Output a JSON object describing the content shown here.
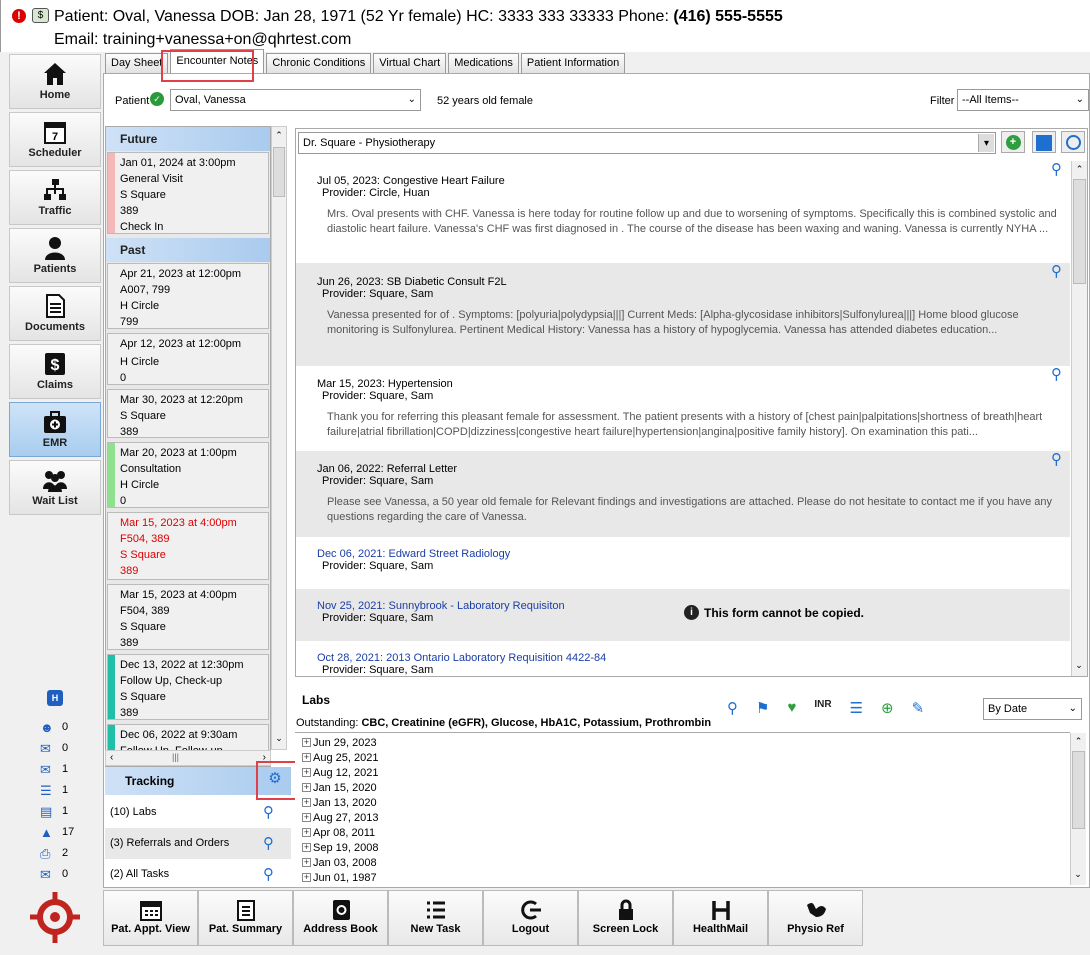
{
  "header": {
    "patient_line": "Patient: Oval, Vanessa DOB: Jan 28, 1971 (52 Yr female) HC: 3333 333 33333 Phone:",
    "phone": "(416) 555-5555",
    "email_line": "Email: training+vanessa+on@qhrtest.com"
  },
  "nav": [
    {
      "label": "Home",
      "icon": "home-icon"
    },
    {
      "label": "Scheduler",
      "icon": "calendar-icon"
    },
    {
      "label": "Traffic",
      "icon": "traffic-icon"
    },
    {
      "label": "Patients",
      "icon": "person-icon"
    },
    {
      "label": "Documents",
      "icon": "document-icon"
    },
    {
      "label": "Claims",
      "icon": "dollar-icon"
    },
    {
      "label": "EMR",
      "icon": "medical-bag-icon"
    },
    {
      "label": "Wait List",
      "icon": "group-icon"
    }
  ],
  "counts": [
    {
      "icon": "person-icon",
      "value": "0"
    },
    {
      "icon": "inbox-icon",
      "value": "0"
    },
    {
      "icon": "mail-icon",
      "value": "1"
    },
    {
      "icon": "task-list-icon",
      "value": "1"
    },
    {
      "icon": "document-icon",
      "value": "1"
    },
    {
      "icon": "lab-flask-icon",
      "value": "17"
    },
    {
      "icon": "printer-icon",
      "value": "2"
    },
    {
      "icon": "message-icon",
      "value": "0"
    }
  ],
  "tabs": [
    "Day Sheet",
    "Encounter Notes",
    "Chronic Conditions",
    "Virtual Chart",
    "Medications",
    "Patient Information"
  ],
  "patient_bar": {
    "patient_label": "Patient",
    "patient_value": "Oval, Vanessa",
    "age_text": "52 years old female",
    "filter_label": "Filter",
    "filter_value": "--All Items--"
  },
  "encounters": {
    "future_label": "Future",
    "past_label": "Past",
    "future": [
      {
        "lines": [
          "Jan 01, 2024 at 3:00pm",
          "General Visit",
          "S Square",
          "389",
          "Check In"
        ],
        "color": "#f5b8b8"
      }
    ],
    "past": [
      {
        "lines": [
          "Apr 21, 2023 at 12:00pm",
          "A007, 799",
          "H Circle",
          "799"
        ],
        "color": ""
      },
      {
        "lines": [
          "Apr 12, 2023 at 12:00pm",
          "H Circle",
          "0"
        ],
        "color": ""
      },
      {
        "lines": [
          "Mar 30, 2023 at 12:20pm",
          "S Square",
          "389"
        ],
        "color": ""
      },
      {
        "lines": [
          "Mar 20, 2023 at 1:00pm",
          "Consultation",
          "H Circle",
          "0"
        ],
        "color": "#8fe08f"
      },
      {
        "lines": [
          "Mar 15, 2023 at 4:00pm",
          "F504, 389",
          "S Square",
          "389"
        ],
        "color": "",
        "red": true
      },
      {
        "lines": [
          "Mar 15, 2023 at 4:00pm",
          "F504, 389",
          "S Square",
          "389"
        ],
        "color": ""
      },
      {
        "lines": [
          "Dec 13, 2022 at 12:30pm",
          "Follow Up, Check-up",
          "S Square",
          "389"
        ],
        "color": "#20c0a8"
      },
      {
        "lines": [
          "Dec 06, 2022 at 9:30am",
          "Follow Up, Follow-up"
        ],
        "color": "#20c0a8"
      }
    ]
  },
  "tracking": {
    "title": "Tracking",
    "rows": [
      "(10) Labs",
      "(3) Referrals and Orders",
      "(2) All Tasks"
    ]
  },
  "notes_header": {
    "provider_select": "Dr. Square - Physiotherapy"
  },
  "notes": [
    {
      "title": "Jul 05, 2023: Congestive Heart Failure",
      "provider": "Provider: Circle, Huan",
      "body": "Mrs. Oval presents with CHF. Vanessa is here today for routine follow up and due to worsening of symptoms. Specifically this is combined systolic and diastolic heart failure. Vanessa's CHF was first diagnosed in . The course of the disease has been waxing and waning. Vanessa is currently NYHA ..."
    },
    {
      "title": "Jun 26, 2023: SB  Diabetic Consult F2L",
      "provider": "Provider: Square, Sam",
      "body": "Vanessa presented for of .    Symptoms: [polyuria|polydypsia|||]     Current Meds: [Alpha-glycosidase inhibitors|Sulfonylurea|||]     Home blood glucose monitoring is Sulfonylurea.    Pertinent Medical History:     Vanessa has a history of hypoglycemia.    Vanessa has attended diabetes education..."
    },
    {
      "title": "Mar 15, 2023: Hypertension",
      "provider": "Provider: Square, Sam",
      "body": "Thank you for referring this pleasant female for assessment. The patient presents with a history of [chest pain|palpitations|shortness of breath|heart failure|atrial fibrillation|COPD|dizziness|congestive heart failure|hypertension|angina|positive family history].      On examination this pati..."
    },
    {
      "title": "Jan 06, 2022: Referral Letter",
      "provider": "Provider: Square, Sam",
      "body": "Please see Vanessa, a 50 year old female for   Relevant findings and investigations are attached.  Please do not hesitate to contact me if you have any questions regarding the care of Vanessa."
    },
    {
      "title": "Dec 06, 2021: Edward Street Radiology",
      "provider": "Provider: Square, Sam"
    },
    {
      "title": "Nov 25, 2021: Sunnybrook - Laboratory Requisiton",
      "provider": "Provider: Square, Sam",
      "notice": "This form cannot be copied."
    },
    {
      "title": "Oct 28, 2021: 2013 Ontario Laboratory Requisition 4422-84",
      "provider": "Provider: Square, Sam"
    }
  ],
  "labs": {
    "title": "Labs",
    "outstanding_label": "Outstanding:",
    "outstanding": "CBC, Creatinine (eGFR), Glucose, HbA1C, Potassium, Prothrombin",
    "sort_value": "By Date",
    "dates": [
      "Jun 29, 2023",
      "Aug 25, 2021",
      "Aug 12, 2021",
      "Jan 15, 2020",
      "Jan 13, 2020",
      "Aug 27, 2013",
      "Apr 08, 2011",
      "Sep 19, 2008",
      "Jan 03, 2008",
      "Jun 01, 1987"
    ]
  },
  "bottom_buttons": [
    {
      "label": "Pat. Appt. View",
      "icon": "calendar-icon"
    },
    {
      "label": "Pat. Summary",
      "icon": "clipboard-icon"
    },
    {
      "label": "Address Book",
      "icon": "address-book-icon"
    },
    {
      "label": "New Task",
      "icon": "task-list-icon"
    },
    {
      "label": "Logout",
      "icon": "logout-icon"
    },
    {
      "label": "Screen Lock",
      "icon": "lock-icon"
    },
    {
      "label": "HealthMail",
      "icon": "health-mail-icon"
    },
    {
      "label": "Physio Ref",
      "icon": "physio-icon"
    }
  ],
  "colors": {
    "accent": "#a9cbee",
    "alert": "#d00000",
    "link": "#1a3ea6",
    "highlight_box": "#e0404a"
  }
}
